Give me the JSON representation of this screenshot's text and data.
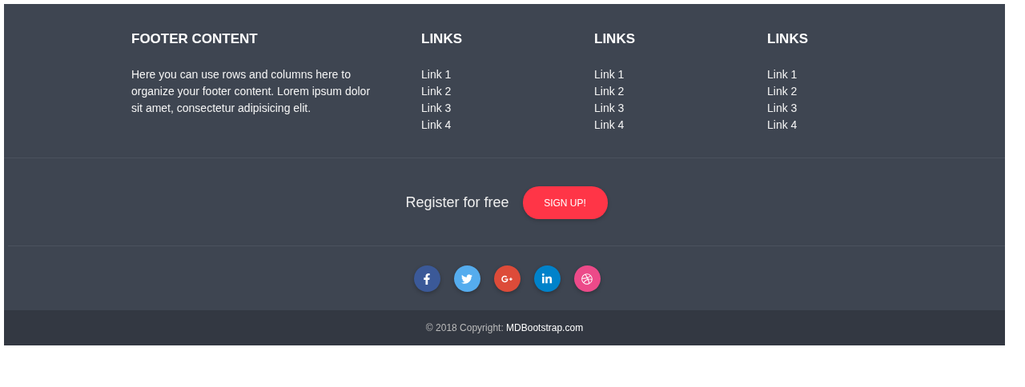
{
  "about": {
    "title": "FOOTER CONTENT",
    "text": "Here you can use rows and columns here to organize your footer content. Lorem ipsum dolor sit amet, consectetur adipisicing elit."
  },
  "link_columns": [
    {
      "title": "LINKS",
      "links": [
        "Link 1",
        "Link 2",
        "Link 3",
        "Link 4"
      ]
    },
    {
      "title": "LINKS",
      "links": [
        "Link 1",
        "Link 2",
        "Link 3",
        "Link 4"
      ]
    },
    {
      "title": "LINKS",
      "links": [
        "Link 1",
        "Link 2",
        "Link 3",
        "Link 4"
      ]
    }
  ],
  "register": {
    "text": "Register for free",
    "button": "SIGN UP!"
  },
  "social": [
    {
      "kind": "facebook",
      "color": "#3b5998"
    },
    {
      "kind": "twitter",
      "color": "#55acee"
    },
    {
      "kind": "googleplus",
      "color": "#dd4b39"
    },
    {
      "kind": "linkedin",
      "color": "#0082ca"
    },
    {
      "kind": "dribbble",
      "color": "#ec4a89"
    }
  ],
  "copyright": {
    "text": "© 2018 Copyright: ",
    "link": "MDBootstrap.com"
  }
}
